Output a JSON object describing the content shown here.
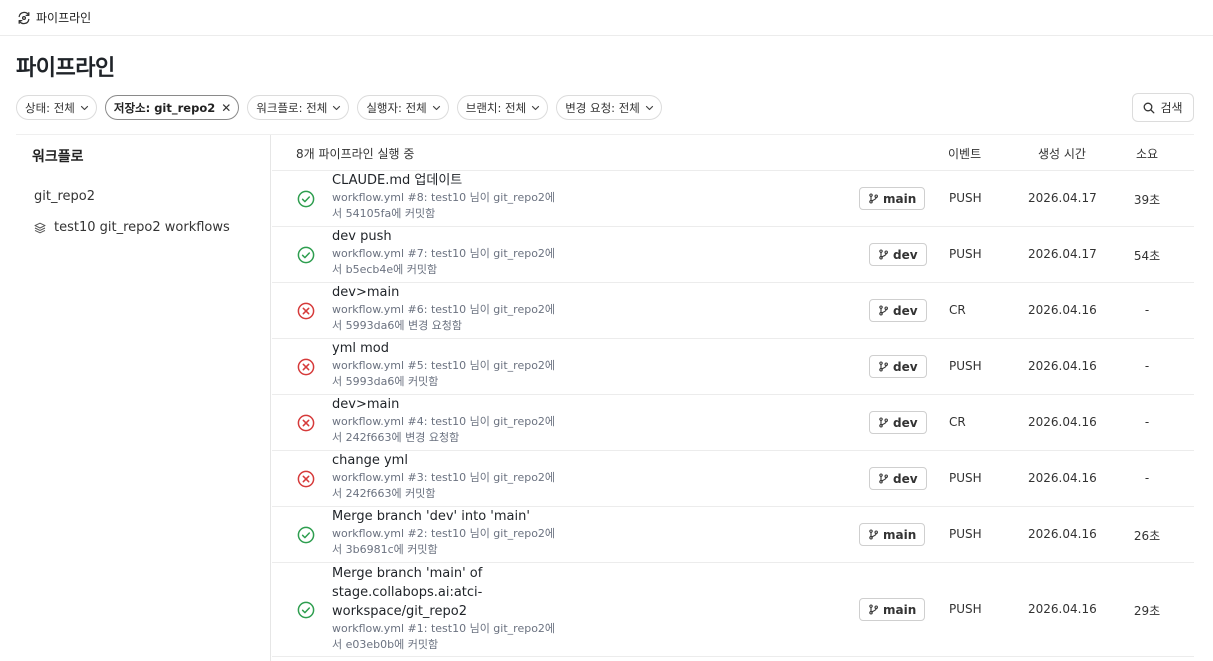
{
  "topbar": {
    "title": "파이프라인",
    "icon": "pipeline-refresh-icon"
  },
  "page": {
    "title": "파이프라인"
  },
  "filters": [
    {
      "label": "상태: 전체",
      "active": false
    },
    {
      "label": "저장소: git_repo2",
      "active": true
    },
    {
      "label": "워크플로: 전체",
      "active": false
    },
    {
      "label": "실행자: 전체",
      "active": false
    },
    {
      "label": "브랜치: 전체",
      "active": false
    },
    {
      "label": "변경 요청: 전체",
      "active": false
    }
  ],
  "search": {
    "label": "검색",
    "icon": "search-icon"
  },
  "sidebar": {
    "title": "워크플로",
    "repo": "git_repo2",
    "workflow": "test10 git_repo2 workflows"
  },
  "table": {
    "count_label": "8개 파이프라인 실행 중",
    "headers": {
      "event": "이벤트",
      "time": "생성 시간",
      "duration": "소요"
    },
    "colors": {
      "success": "#2e9e4f",
      "failed": "#d63a3a"
    },
    "rows": [
      {
        "status": "success",
        "title": "CLAUDE.md 업데이트",
        "desc1": "workflow.yml #8: test10 님이 git_repo2에",
        "desc2": "서 54105fa에 커밋함",
        "branch": "main",
        "event": "PUSH",
        "time": "2026.04.17",
        "duration": "39초"
      },
      {
        "status": "success",
        "title": "dev push",
        "desc1": "workflow.yml #7: test10 님이 git_repo2에",
        "desc2": "서 b5ecb4e에 커밋함",
        "branch": "dev",
        "event": "PUSH",
        "time": "2026.04.17",
        "duration": "54초"
      },
      {
        "status": "failed",
        "title": "dev>main",
        "desc1": "workflow.yml #6: test10 님이 git_repo2에",
        "desc2": "서 5993da6에 변경 요청함",
        "branch": "dev",
        "event": "CR",
        "time": "2026.04.16",
        "duration": "-"
      },
      {
        "status": "failed",
        "title": "yml mod",
        "desc1": "workflow.yml #5: test10 님이 git_repo2에",
        "desc2": "서 5993da6에 커밋함",
        "branch": "dev",
        "event": "PUSH",
        "time": "2026.04.16",
        "duration": "-"
      },
      {
        "status": "failed",
        "title": "dev>main",
        "desc1": "workflow.yml #4: test10 님이 git_repo2에",
        "desc2": "서 242f663에 변경 요청함",
        "branch": "dev",
        "event": "CR",
        "time": "2026.04.16",
        "duration": "-"
      },
      {
        "status": "failed",
        "title": "change yml",
        "desc1": "workflow.yml #3: test10 님이 git_repo2에",
        "desc2": "서 242f663에 커밋함",
        "branch": "dev",
        "event": "PUSH",
        "time": "2026.04.16",
        "duration": "-"
      },
      {
        "status": "success",
        "title": "Merge branch 'dev' into 'main'",
        "desc1": "workflow.yml #2: test10 님이 git_repo2에",
        "desc2": "서 3b6981c에 커밋함",
        "branch": "main",
        "event": "PUSH",
        "time": "2026.04.16",
        "duration": "26초"
      },
      {
        "status": "success",
        "title": "Merge branch 'main' of stage.collabops.ai:atci-workspace/git_repo2",
        "desc1": "workflow.yml #1: test10 님이 git_repo2에",
        "desc2": "서 e03eb0b에 커밋함",
        "branch": "main",
        "event": "PUSH",
        "time": "2026.04.16",
        "duration": "29초"
      }
    ]
  }
}
